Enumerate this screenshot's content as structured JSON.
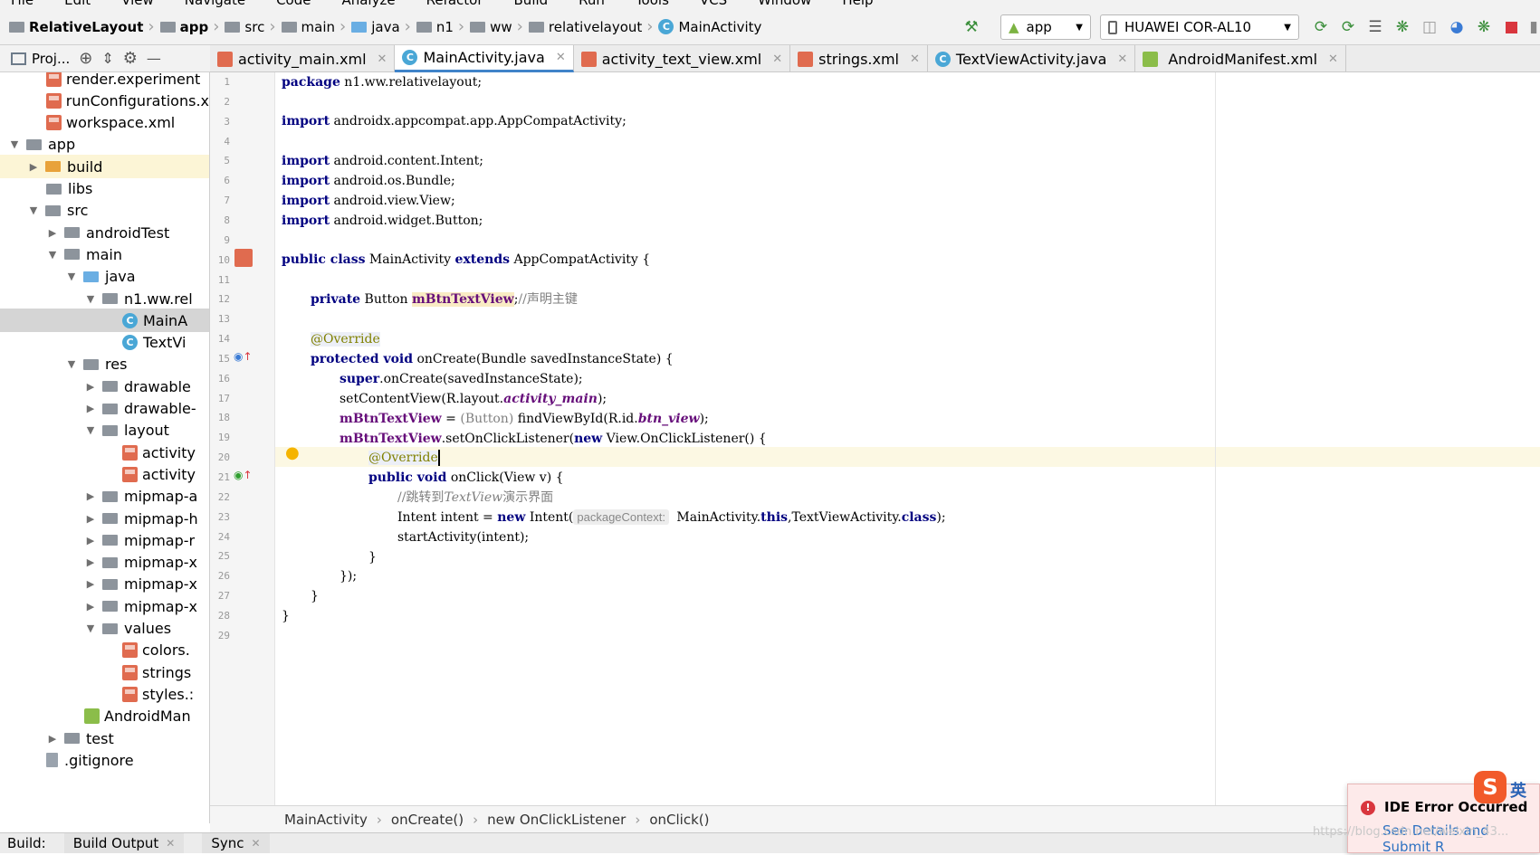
{
  "menu": [
    "File",
    "Edit",
    "View",
    "Navigate",
    "Code",
    "Analyze",
    "Refactor",
    "Build",
    "Run",
    "Tools",
    "VCS",
    "Window",
    "Help"
  ],
  "breadcrumb": [
    "RelativeLayout",
    "app",
    "src",
    "main",
    "java",
    "n1",
    "ww",
    "relativelayout",
    "MainActivity"
  ],
  "run_config": "app",
  "device": "HUAWEI COR-AL10",
  "project_panel_title": "Proj...",
  "tabs": [
    {
      "label": "activity_main.xml",
      "type": "xml"
    },
    {
      "label": "MainActivity.java",
      "type": "class",
      "active": true
    },
    {
      "label": "activity_text_view.xml",
      "type": "xml"
    },
    {
      "label": "strings.xml",
      "type": "xml"
    },
    {
      "label": "TextViewActivity.java",
      "type": "class"
    },
    {
      "label": "AndroidManifest.xml",
      "type": "mf"
    }
  ],
  "tree": [
    {
      "label": "render.experiment",
      "icon": "xml",
      "indent": 3
    },
    {
      "label": "runConfigurations.x",
      "icon": "xml",
      "indent": 3
    },
    {
      "label": "workspace.xml",
      "icon": "xml",
      "indent": 3
    },
    {
      "label": "app",
      "icon": "folder",
      "arrow": "down",
      "indent": 1
    },
    {
      "label": "build",
      "icon": "folder-orange",
      "arrow": "right",
      "indent": 2,
      "highlight": true
    },
    {
      "label": "libs",
      "icon": "folder",
      "indent": 3
    },
    {
      "label": "src",
      "icon": "folder",
      "arrow": "down",
      "indent": 2
    },
    {
      "label": "androidTest",
      "icon": "folder",
      "arrow": "right",
      "indent": 3
    },
    {
      "label": "main",
      "icon": "folder",
      "arrow": "down",
      "indent": 3
    },
    {
      "label": "java",
      "icon": "folder-blue",
      "arrow": "down",
      "indent": 4
    },
    {
      "label": "n1.ww.rel",
      "icon": "folder",
      "arrow": "down",
      "indent": 5
    },
    {
      "label": "MainA",
      "icon": "class",
      "indent": 7,
      "selected": true
    },
    {
      "label": "TextVi",
      "icon": "class",
      "indent": 7
    },
    {
      "label": "res",
      "icon": "folder",
      "arrow": "down",
      "indent": 4
    },
    {
      "label": "drawable",
      "icon": "folder",
      "arrow": "right",
      "indent": 5
    },
    {
      "label": "drawable-",
      "icon": "folder",
      "arrow": "right",
      "indent": 5
    },
    {
      "label": "layout",
      "icon": "folder",
      "arrow": "down",
      "indent": 5
    },
    {
      "label": "activity",
      "icon": "xml",
      "indent": 7
    },
    {
      "label": "activity",
      "icon": "xml",
      "indent": 7
    },
    {
      "label": "mipmap-a",
      "icon": "folder",
      "arrow": "right",
      "indent": 5
    },
    {
      "label": "mipmap-h",
      "icon": "folder",
      "arrow": "right",
      "indent": 5
    },
    {
      "label": "mipmap-r",
      "icon": "folder",
      "arrow": "right",
      "indent": 5
    },
    {
      "label": "mipmap-x",
      "icon": "folder",
      "arrow": "right",
      "indent": 5
    },
    {
      "label": "mipmap-x",
      "icon": "folder",
      "arrow": "right",
      "indent": 5
    },
    {
      "label": "mipmap-x",
      "icon": "folder",
      "arrow": "right",
      "indent": 5
    },
    {
      "label": "values",
      "icon": "folder",
      "arrow": "down",
      "indent": 5
    },
    {
      "label": "colors.",
      "icon": "xml",
      "indent": 7
    },
    {
      "label": "strings",
      "icon": "xml",
      "indent": 7
    },
    {
      "label": "styles.:",
      "icon": "xml",
      "indent": 7
    },
    {
      "label": "AndroidMan",
      "icon": "mf",
      "indent": 5
    },
    {
      "label": "test",
      "icon": "folder",
      "arrow": "right",
      "indent": 3
    },
    {
      "label": ".gitignore",
      "icon": "file",
      "indent": 3
    }
  ],
  "line_numbers": [
    "1",
    "2",
    "3",
    "4",
    "5",
    "6",
    "7",
    "8",
    "9",
    "10",
    "11",
    "12",
    "13",
    "14",
    "15",
    "16",
    "17",
    "18",
    "19",
    "20",
    "21",
    "22",
    "23",
    "24",
    "25",
    "26",
    "27",
    "28",
    "29"
  ],
  "code": {
    "l1_kw": "package",
    "l1": " n1.ww.relativelayout;",
    "l3_kw": "import",
    "l3": " androidx.appcompat.app.AppCompatActivity;",
    "l5_kw": "import",
    "l5": " android.content.Intent;",
    "l6_kw": "import",
    "l6": " android.os.Bundle;",
    "l7_kw": "import",
    "l7": " android.view.View;",
    "l8_kw": "import",
    "l8": " android.widget.Button;",
    "l10_kw1": "public class",
    "l10_a": " MainActivity ",
    "l10_kw2": "extends",
    "l10_b": " AppCompatActivity {",
    "l12_kw": "private",
    "l12_a": " Button ",
    "l12_fld": "mBtnTextView",
    "l12_b": ";",
    "l12_cmt": "//声明主键",
    "l14_ann": "@Override",
    "l15_kw": "protected void",
    "l15": " onCreate(Bundle savedInstanceState) {",
    "l16_kw": "super",
    "l16": ".onCreate(savedInstanceState);",
    "l17_a": "setContentView(R.layout.",
    "l17_it": "activity_main",
    "l17_b": ");",
    "l18_fld": "mBtnTextView",
    "l18_a": " = ",
    "l18_cast": "(Button)",
    "l18_b": " findViewById(R.id.",
    "l18_it": "btn_view",
    "l18_c": ");",
    "l19_fld": "mBtnTextView",
    "l19_a": ".setOnClickListener(",
    "l19_kw": "new",
    "l19_b": " View.OnClickListener() {",
    "l20_ann": "@Override",
    "l21_kw": "public void",
    "l21": " onClick(View v) {",
    "l22_cmt1": "//跳转到",
    "l22_cmt_it": "TextView",
    "l22_cmt2": "演示界面",
    "l23_a": "Intent intent = ",
    "l23_kw": "new",
    "l23_b": " Intent(",
    "l23_hint": "packageContext:",
    "l23_c": " MainActivity.",
    "l23_kw2": "this",
    "l23_d": ",TextViewActivity.",
    "l23_kw3": "class",
    "l23_e": ");",
    "l24": "startActivity(intent);",
    "l25": "}",
    "l26": "});",
    "l27": "}",
    "l28": "}"
  },
  "editor_breadcrumb": [
    "MainActivity",
    "onCreate()",
    "new OnClickListener",
    "onClick()"
  ],
  "bottom_tabs": [
    "Build:",
    "Build Output",
    "Sync"
  ],
  "notification": {
    "title": "IDE Error Occurred",
    "link": "See Details and Submit R"
  },
  "ime": {
    "logo": "S",
    "lang": "英"
  },
  "watermark": "https://blog.csdn.net/weixin_43..."
}
